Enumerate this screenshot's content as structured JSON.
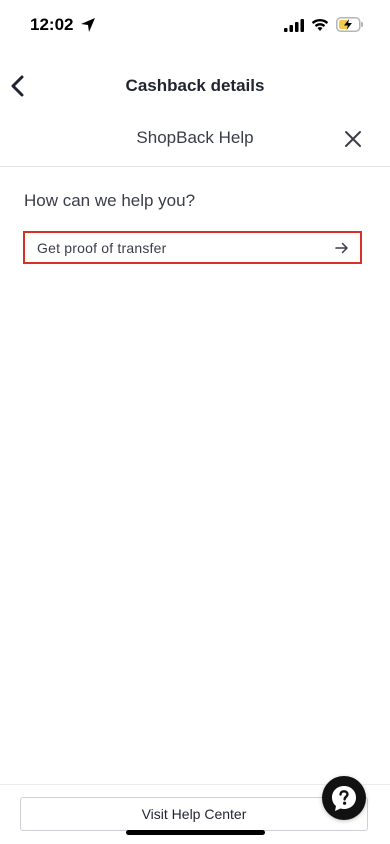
{
  "status_bar": {
    "time": "12:02",
    "icons": [
      "location-arrow-icon",
      "cellular-signal-icon",
      "wifi-icon",
      "battery-charging-icon"
    ]
  },
  "nav": {
    "title": "Cashback details",
    "back_icon": "chevron-left-icon"
  },
  "help_panel": {
    "title": "ShopBack Help",
    "close_icon": "close-icon",
    "question": "How can we help you?",
    "options": [
      {
        "label": "Get proof of transfer",
        "icon": "arrow-right-icon"
      }
    ],
    "visit_button_label": "Visit Help Center",
    "chat_icon": "help-chat-icon"
  },
  "colors": {
    "highlight_border": "#d93025",
    "text_primary": "#1f2430",
    "text_secondary": "#3a3d49",
    "chat_fab": "#111111"
  }
}
